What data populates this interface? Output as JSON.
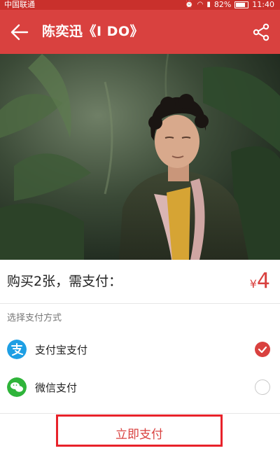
{
  "status_bar": {
    "carrier": "中国联通",
    "battery": "82%",
    "battery_level": 0.82,
    "time": "11:40"
  },
  "header": {
    "title": "陈奕迅《I DO》",
    "back_icon": "arrow-left-icon",
    "share_icon": "share-icon"
  },
  "purchase": {
    "summary": "购买2张，需支付：",
    "currency_symbol": "¥",
    "amount": "4"
  },
  "payment": {
    "section_label": "选择支付方式",
    "options": [
      {
        "label": "支付宝支付",
        "icon": "alipay-icon",
        "selected": true
      },
      {
        "label": "微信支付",
        "icon": "wechat-icon",
        "selected": false
      }
    ]
  },
  "pay_button": {
    "label": "立即支付"
  },
  "colors": {
    "accent": "#d9413f",
    "alipay": "#1e9fe4",
    "wechat": "#2fb43a",
    "highlight_border": "#e8222a"
  }
}
